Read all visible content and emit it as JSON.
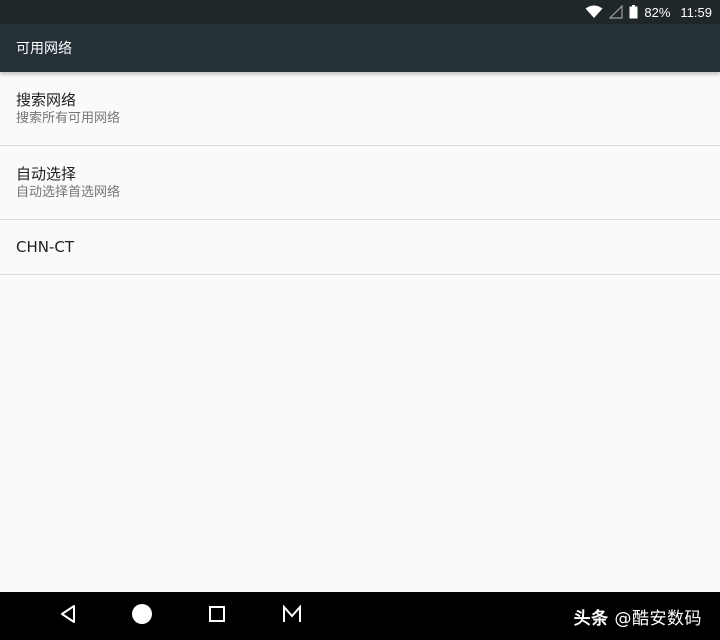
{
  "status_bar": {
    "battery_percent": "82%",
    "time": "11:59",
    "icons": [
      "wifi-icon",
      "cell-signal-icon",
      "battery-icon"
    ]
  },
  "app_bar": {
    "title": "可用网络"
  },
  "list": {
    "items": [
      {
        "title": "搜索网络",
        "summary": "搜索所有可用网络"
      },
      {
        "title": "自动选择",
        "summary": "自动选择首选网络"
      },
      {
        "title": "CHN-CT"
      }
    ]
  },
  "nav_bar": {
    "buttons": [
      "back-icon",
      "home-icon",
      "recents-icon",
      "menu-m-icon"
    ],
    "watermark_brand": "头条",
    "watermark_handle": "@酷安数码"
  },
  "colors": {
    "status_bar_bg": "#1f272b",
    "app_bar_bg": "#263238",
    "page_bg": "#fafafa",
    "nav_bar_bg": "#000000"
  }
}
